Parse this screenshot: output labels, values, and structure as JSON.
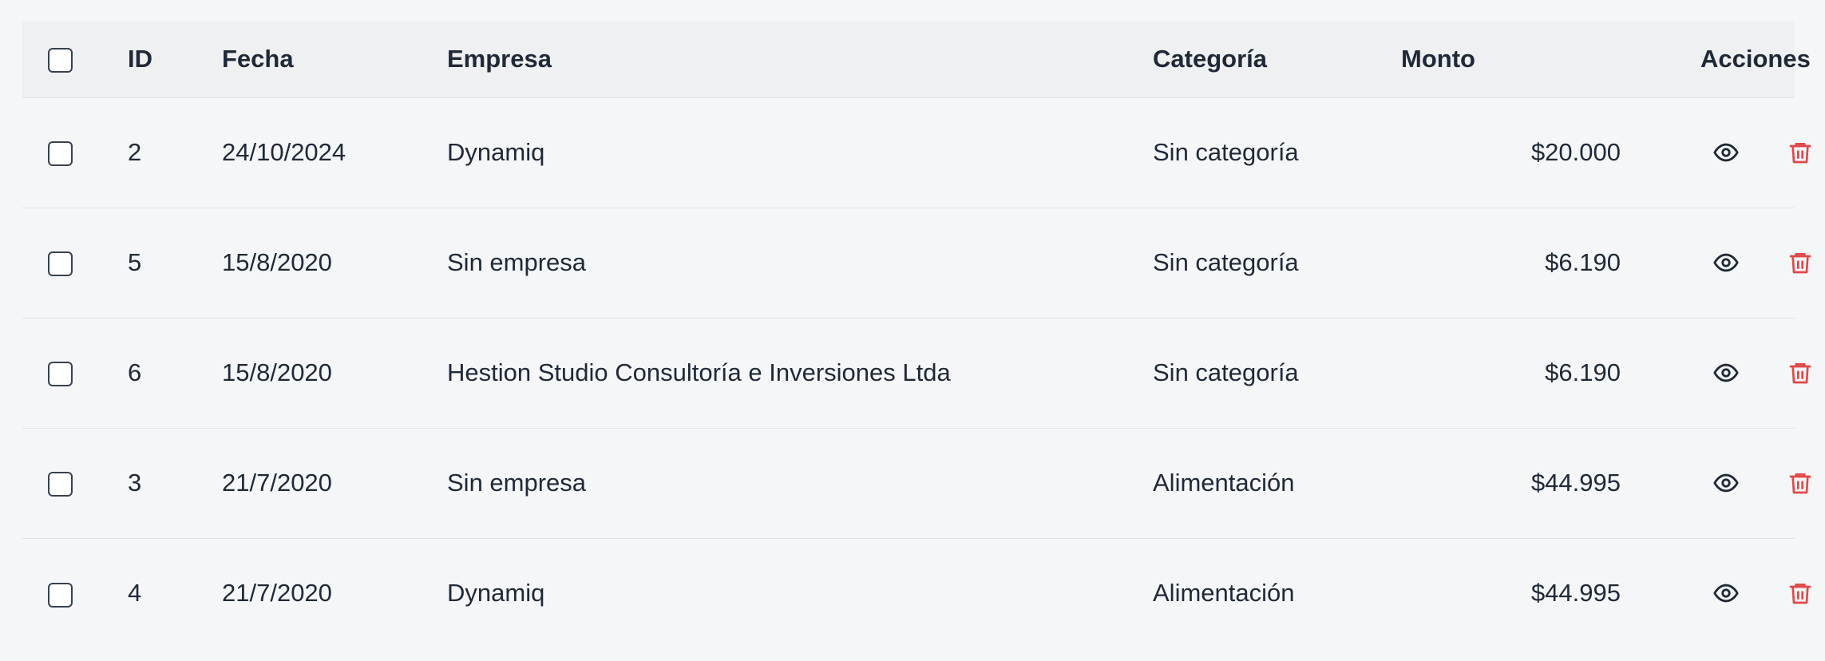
{
  "table": {
    "headers": {
      "id": "ID",
      "date": "Fecha",
      "company": "Empresa",
      "category": "Categoría",
      "amount": "Monto",
      "actions": "Acciones"
    },
    "rows": [
      {
        "id": "2",
        "date": "24/10/2024",
        "company": "Dynamiq",
        "category": "Sin categoría",
        "amount": "$20.000"
      },
      {
        "id": "5",
        "date": "15/8/2020",
        "company": "Sin empresa",
        "category": "Sin categoría",
        "amount": "$6.190"
      },
      {
        "id": "6",
        "date": "15/8/2020",
        "company": "Hestion Studio Consultoría e Inversiones Ltda",
        "category": "Sin categoría",
        "amount": "$6.190"
      },
      {
        "id": "3",
        "date": "21/7/2020",
        "company": "Sin empresa",
        "category": "Alimentación",
        "amount": "$44.995"
      },
      {
        "id": "4",
        "date": "21/7/2020",
        "company": "Dynamiq",
        "category": "Alimentación",
        "amount": "$44.995"
      }
    ],
    "icons": {
      "view": "eye-icon",
      "delete": "trash-icon"
    },
    "colors": {
      "delete": "#e04848",
      "view": "#1f2937"
    }
  }
}
